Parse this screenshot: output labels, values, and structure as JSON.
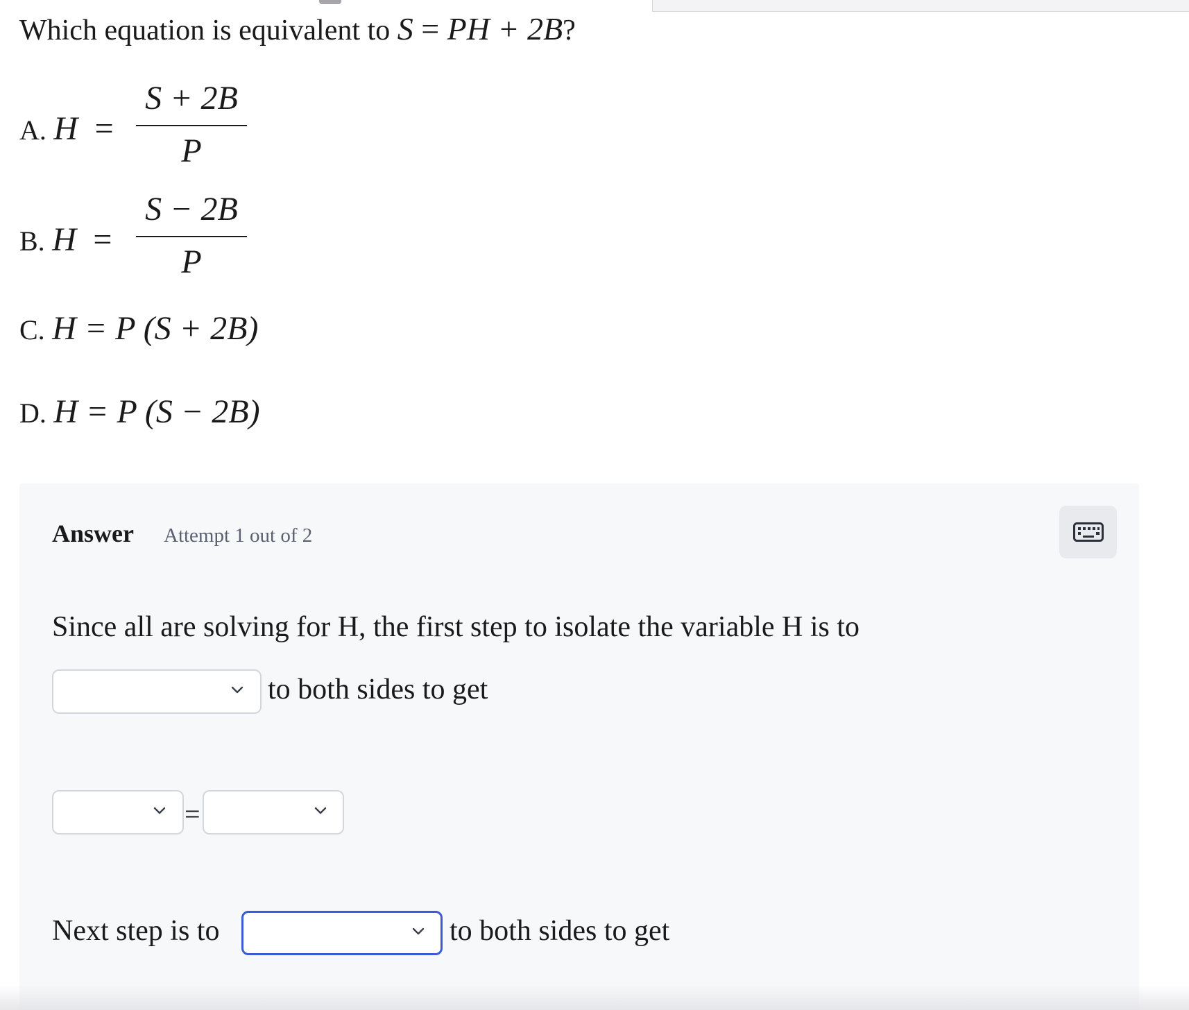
{
  "question": {
    "prefix": "Which equation is equivalent to ",
    "eq_lhs": "S",
    "eq_sign": " = ",
    "eq_rhs": "PH + 2B",
    "suffix": "?"
  },
  "options": [
    {
      "letter": "A.",
      "lhs": "H",
      "sign": "=",
      "numerator": "S + 2B",
      "denominator": "P"
    },
    {
      "letter": "B.",
      "lhs": "H",
      "sign": "=",
      "numerator": "S − 2B",
      "denominator": "P"
    },
    {
      "letter": "C.",
      "expr": "H = P (S + 2B)"
    },
    {
      "letter": "D.",
      "expr": "H = P (S − 2B)"
    }
  ],
  "answer": {
    "title": "Answer",
    "attempt": "Attempt 1 out of 2",
    "keyboard_icon": "keyboard-icon",
    "step1_text": "Since all are solving for H, the first step to isolate the variable H is to",
    "step1_after": "to both sides to get",
    "equals": "=",
    "step2_before": "Next step is to",
    "step2_after": "to both sides to get",
    "dropdown_1_value": "",
    "dropdown_lhs_value": "",
    "dropdown_rhs_value": "",
    "dropdown_2_value": ""
  },
  "colors": {
    "panel_bg": "#f7f8fa",
    "active_border": "#3a5ad6",
    "muted_text": "#5b6070"
  }
}
